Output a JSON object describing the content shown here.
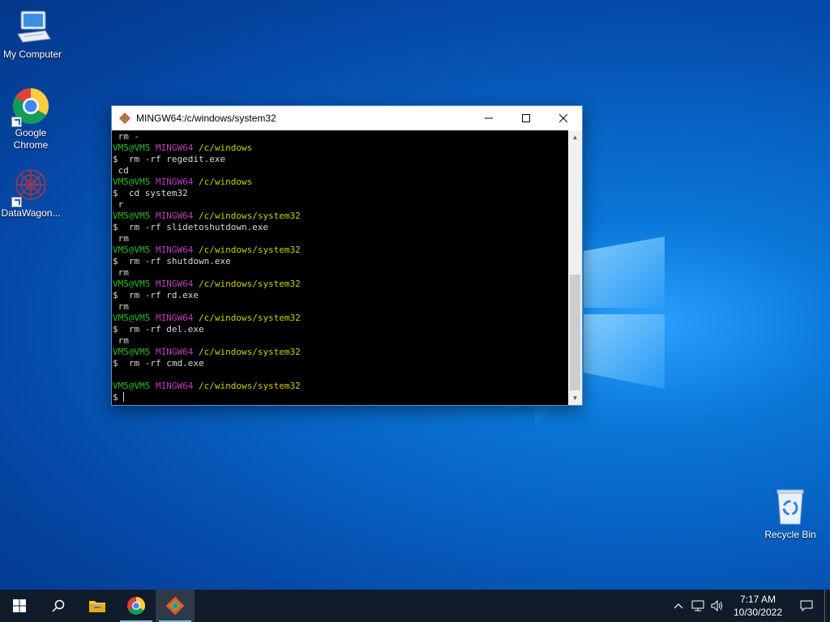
{
  "desktop": {
    "icons": [
      {
        "label": "My Computer",
        "icon": "computer-icon"
      },
      {
        "label": "Google Chrome",
        "icon": "chrome-icon"
      },
      {
        "label": "DataWagon...",
        "icon": "datawagon-icon"
      },
      {
        "label": "Recycle Bin",
        "icon": "recycle-bin-icon"
      }
    ]
  },
  "terminal": {
    "title": "MINGW64:/c/windows/system32",
    "colors": {
      "user": "#25bc24",
      "host": "#bc3fbc",
      "path": "#cdcd00",
      "background": "#000000"
    },
    "lines": [
      {
        "type": "out",
        "text": " rm -"
      },
      {
        "type": "prompt",
        "user": "VM5@VM5",
        "host": "MINGW64",
        "path": "/c/windows"
      },
      {
        "type": "cmd",
        "text": "$  rm -rf regedit.exe"
      },
      {
        "type": "out",
        "text": " cd"
      },
      {
        "type": "prompt",
        "user": "VM5@VM5",
        "host": "MINGW64",
        "path": "/c/windows"
      },
      {
        "type": "cmd",
        "text": "$  cd system32"
      },
      {
        "type": "out",
        "text": " r"
      },
      {
        "type": "prompt",
        "user": "VM5@VM5",
        "host": "MINGW64",
        "path": "/c/windows/system32"
      },
      {
        "type": "cmd",
        "text": "$  rm -rf slidetoshutdown.exe"
      },
      {
        "type": "out",
        "text": " rm"
      },
      {
        "type": "prompt",
        "user": "VM5@VM5",
        "host": "MINGW64",
        "path": "/c/windows/system32"
      },
      {
        "type": "cmd",
        "text": "$  rm -rf shutdown.exe"
      },
      {
        "type": "out",
        "text": " rm"
      },
      {
        "type": "prompt",
        "user": "VM5@VM5",
        "host": "MINGW64",
        "path": "/c/windows/system32"
      },
      {
        "type": "cmd",
        "text": "$  rm -rf rd.exe"
      },
      {
        "type": "out",
        "text": " rm"
      },
      {
        "type": "prompt",
        "user": "VM5@VM5",
        "host": "MINGW64",
        "path": "/c/windows/system32"
      },
      {
        "type": "cmd",
        "text": "$  rm -rf del.exe"
      },
      {
        "type": "out",
        "text": " rm"
      },
      {
        "type": "prompt",
        "user": "VM5@VM5",
        "host": "MINGW64",
        "path": "/c/windows/system32"
      },
      {
        "type": "cmd",
        "text": "$  rm -rf cmd.exe"
      },
      {
        "type": "out",
        "text": ""
      },
      {
        "type": "prompt",
        "user": "VM5@VM5",
        "host": "MINGW64",
        "path": "/c/windows/system32"
      },
      {
        "type": "input",
        "text": "$ "
      }
    ]
  },
  "taskbar": {
    "buttons": [
      {
        "name": "start-button",
        "icon": "windows-icon"
      },
      {
        "name": "search-button",
        "icon": "search-icon"
      },
      {
        "name": "file-explorer-button",
        "icon": "folder-icon"
      },
      {
        "name": "chrome-taskbar-button",
        "icon": "chrome-icon"
      },
      {
        "name": "git-bash-taskbar-button",
        "icon": "git-icon"
      }
    ],
    "clock": {
      "time": "7:17 AM",
      "date": "10/30/2022"
    }
  }
}
